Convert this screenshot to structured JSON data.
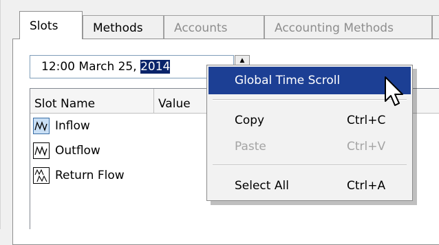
{
  "tabs": [
    {
      "label": "Slots",
      "active": true,
      "enabled": true
    },
    {
      "label": "Methods",
      "active": false,
      "enabled": true
    },
    {
      "label": "Accounts",
      "active": false,
      "enabled": false
    },
    {
      "label": "Accounting Methods",
      "active": false,
      "enabled": false
    }
  ],
  "date_field": {
    "prefix": "12:00 March 25, ",
    "selected": "2014"
  },
  "table": {
    "columns": [
      "Slot Name",
      "Value"
    ],
    "rows": [
      {
        "name": "Inflow",
        "icon": "series-slot-icon",
        "selected": true
      },
      {
        "name": "Outflow",
        "icon": "series-slot-icon",
        "selected": false
      },
      {
        "name": "Return Flow",
        "icon": "multi-series-slot-icon",
        "selected": false
      }
    ]
  },
  "context_menu": {
    "items": [
      {
        "label": "Global Time Scroll",
        "shortcut": "",
        "highlighted": true,
        "enabled": true
      },
      {
        "label": "Copy",
        "shortcut": "Ctrl+C",
        "highlighted": false,
        "enabled": true
      },
      {
        "label": "Paste",
        "shortcut": "Ctrl+V",
        "highlighted": false,
        "enabled": false
      },
      {
        "label": "Select All",
        "shortcut": "Ctrl+A",
        "highlighted": false,
        "enabled": true
      }
    ]
  },
  "colors": {
    "menu_highlight": "#1c3f94",
    "text_selection": "#0a246a",
    "disabled_text": "#8d8d8d"
  }
}
